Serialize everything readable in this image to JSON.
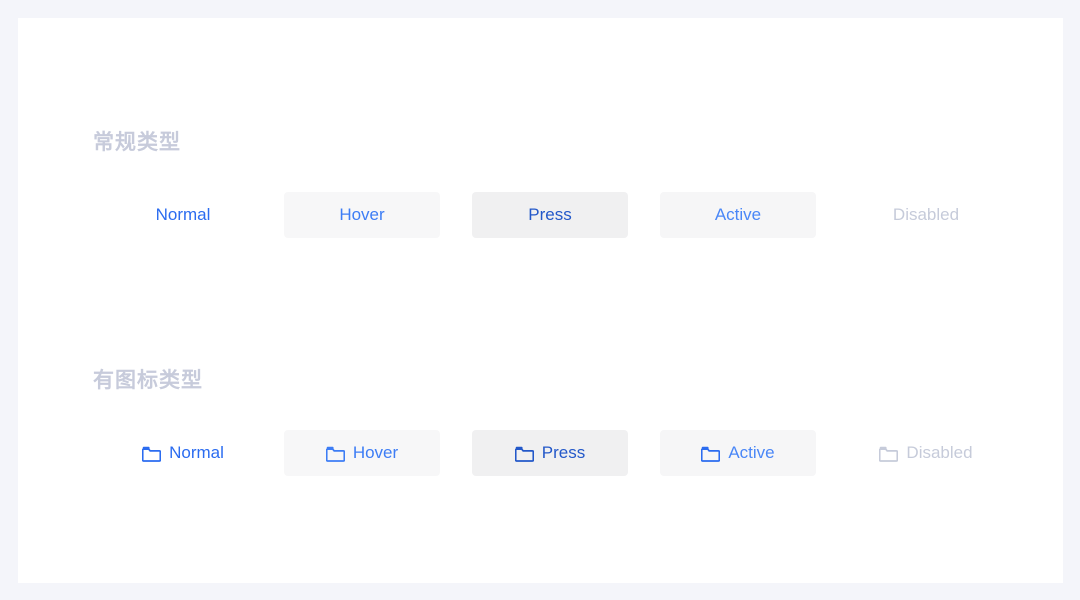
{
  "page": {
    "background_color": "#f4f5fa",
    "card_background_color": "#ffffff"
  },
  "sections": [
    {
      "id": "normal-type",
      "title": "常规类型",
      "title_color": "#c7cbdb",
      "buttons": [
        {
          "label": "Normal",
          "state": "normal",
          "text_color": "#2b6cf0",
          "background": "transparent",
          "has_icon": false,
          "disabled": false
        },
        {
          "label": "Hover",
          "state": "hover",
          "text_color": "#3d7df5",
          "background": "#f7f7f8",
          "has_icon": false,
          "disabled": false
        },
        {
          "label": "Press",
          "state": "press",
          "text_color": "#2358c9",
          "background": "#f0f0f1",
          "has_icon": false,
          "disabled": false
        },
        {
          "label": "Active",
          "state": "active",
          "text_color": "#4a87f7",
          "background": "#f6f6f7",
          "has_icon": false,
          "disabled": false
        },
        {
          "label": "Disabled",
          "state": "disabled",
          "text_color": "#c6cbda",
          "background": "transparent",
          "has_icon": false,
          "disabled": true
        }
      ]
    },
    {
      "id": "icon-type",
      "title": "有图标类型",
      "title_color": "#c7cbdb",
      "buttons": [
        {
          "label": "Normal",
          "state": "normal",
          "text_color": "#2b6cf0",
          "background": "transparent",
          "has_icon": true,
          "icon": "folder-icon",
          "icon_color": "#2b6cf0",
          "disabled": false
        },
        {
          "label": "Hover",
          "state": "hover",
          "text_color": "#3d7df5",
          "background": "#f7f7f8",
          "has_icon": true,
          "icon": "folder-icon",
          "icon_color": "#3d7df5",
          "disabled": false
        },
        {
          "label": "Press",
          "state": "press",
          "text_color": "#2358c9",
          "background": "#f0f0f1",
          "has_icon": true,
          "icon": "folder-icon",
          "icon_color": "#2358c9",
          "disabled": false
        },
        {
          "label": "Active",
          "state": "active",
          "text_color": "#4a87f7",
          "background": "#f6f6f7",
          "has_icon": true,
          "icon": "folder-icon",
          "icon_color": "#2b6cf0",
          "disabled": false
        },
        {
          "label": "Disabled",
          "state": "disabled",
          "text_color": "#c6cbda",
          "background": "transparent",
          "has_icon": true,
          "icon": "folder-icon",
          "icon_color": "#c6cbda",
          "disabled": true
        }
      ]
    }
  ]
}
